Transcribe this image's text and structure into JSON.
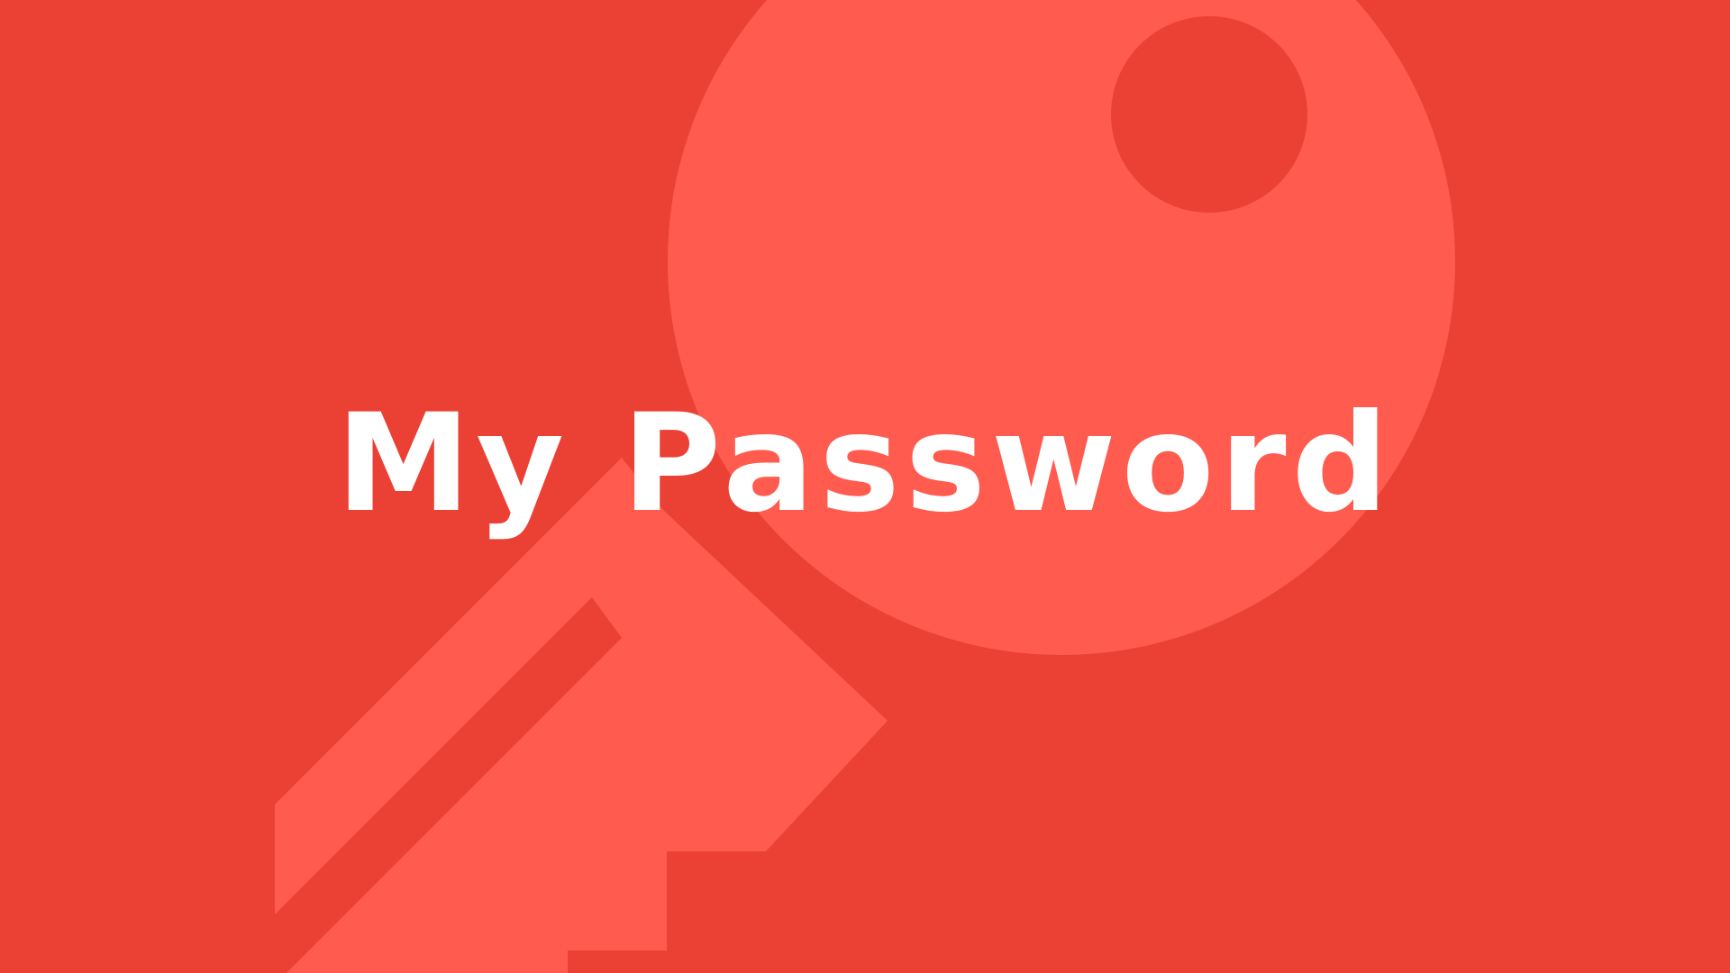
{
  "hero": {
    "title": "My Password"
  },
  "colors": {
    "background": "#EB4135",
    "key_shape": "#FF5B4E",
    "title_text": "#FFFFFF"
  },
  "icons": {
    "background_art": "key-icon"
  }
}
